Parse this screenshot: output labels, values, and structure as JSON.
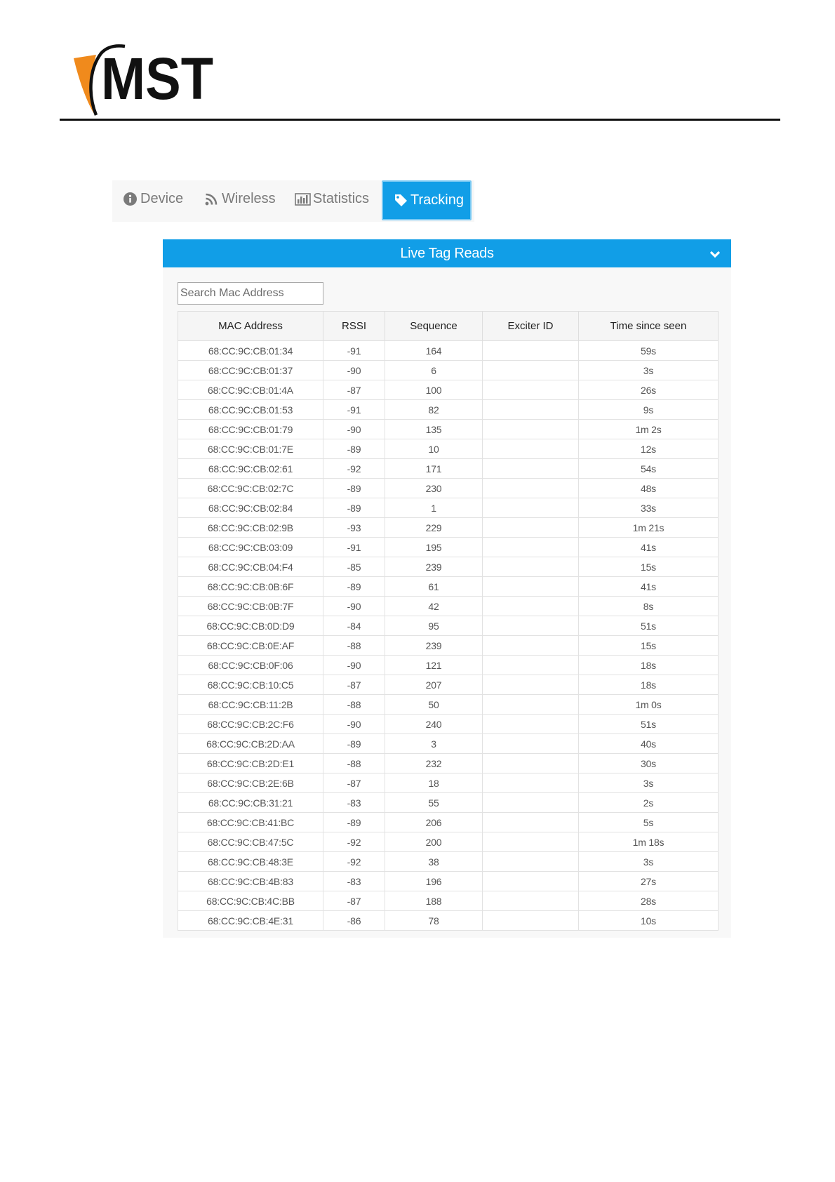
{
  "colors": {
    "primary": "#119ee7",
    "logo_orange": "#f08a1c",
    "logo_ink": "#111111"
  },
  "logo": {
    "text": "MST"
  },
  "tabs": [
    {
      "label": "Device",
      "icon": "info-circle-icon",
      "active": false
    },
    {
      "label": "Wireless",
      "icon": "rss-icon",
      "active": false
    },
    {
      "label": "Statistics",
      "icon": "bar-chart-icon",
      "active": false
    },
    {
      "label": "Tracking",
      "icon": "tag-icon",
      "active": true
    }
  ],
  "panel": {
    "title": "Live Tag Reads",
    "collapse_icon": "chevron-down-icon"
  },
  "search": {
    "placeholder": "Search Mac Address",
    "value": ""
  },
  "table": {
    "columns": [
      "MAC Address",
      "RSSI",
      "Sequence",
      "Exciter ID",
      "Time since seen"
    ],
    "rows": [
      [
        "68:CC:9C:CB:01:34",
        "-91",
        "164",
        "",
        "59s"
      ],
      [
        "68:CC:9C:CB:01:37",
        "-90",
        "6",
        "",
        "3s"
      ],
      [
        "68:CC:9C:CB:01:4A",
        "-87",
        "100",
        "",
        "26s"
      ],
      [
        "68:CC:9C:CB:01:53",
        "-91",
        "82",
        "",
        "9s"
      ],
      [
        "68:CC:9C:CB:01:79",
        "-90",
        "135",
        "",
        "1m 2s"
      ],
      [
        "68:CC:9C:CB:01:7E",
        "-89",
        "10",
        "",
        "12s"
      ],
      [
        "68:CC:9C:CB:02:61",
        "-92",
        "171",
        "",
        "54s"
      ],
      [
        "68:CC:9C:CB:02:7C",
        "-89",
        "230",
        "",
        "48s"
      ],
      [
        "68:CC:9C:CB:02:84",
        "-89",
        "1",
        "",
        "33s"
      ],
      [
        "68:CC:9C:CB:02:9B",
        "-93",
        "229",
        "",
        "1m 21s"
      ],
      [
        "68:CC:9C:CB:03:09",
        "-91",
        "195",
        "",
        "41s"
      ],
      [
        "68:CC:9C:CB:04:F4",
        "-85",
        "239",
        "",
        "15s"
      ],
      [
        "68:CC:9C:CB:0B:6F",
        "-89",
        "61",
        "",
        "41s"
      ],
      [
        "68:CC:9C:CB:0B:7F",
        "-90",
        "42",
        "",
        "8s"
      ],
      [
        "68:CC:9C:CB:0D:D9",
        "-84",
        "95",
        "",
        "51s"
      ],
      [
        "68:CC:9C:CB:0E:AF",
        "-88",
        "239",
        "",
        "15s"
      ],
      [
        "68:CC:9C:CB:0F:06",
        "-90",
        "121",
        "",
        "18s"
      ],
      [
        "68:CC:9C:CB:10:C5",
        "-87",
        "207",
        "",
        "18s"
      ],
      [
        "68:CC:9C:CB:11:2B",
        "-88",
        "50",
        "",
        "1m 0s"
      ],
      [
        "68:CC:9C:CB:2C:F6",
        "-90",
        "240",
        "",
        "51s"
      ],
      [
        "68:CC:9C:CB:2D:AA",
        "-89",
        "3",
        "",
        "40s"
      ],
      [
        "68:CC:9C:CB:2D:E1",
        "-88",
        "232",
        "",
        "30s"
      ],
      [
        "68:CC:9C:CB:2E:6B",
        "-87",
        "18",
        "",
        "3s"
      ],
      [
        "68:CC:9C:CB:31:21",
        "-83",
        "55",
        "",
        "2s"
      ],
      [
        "68:CC:9C:CB:41:BC",
        "-89",
        "206",
        "",
        "5s"
      ],
      [
        "68:CC:9C:CB:47:5C",
        "-92",
        "200",
        "",
        "1m 18s"
      ],
      [
        "68:CC:9C:CB:48:3E",
        "-92",
        "38",
        "",
        "3s"
      ],
      [
        "68:CC:9C:CB:4B:83",
        "-83",
        "196",
        "",
        "27s"
      ],
      [
        "68:CC:9C:CB:4C:BB",
        "-87",
        "188",
        "",
        "28s"
      ],
      [
        "68:CC:9C:CB:4E:31",
        "-86",
        "78",
        "",
        "10s"
      ]
    ]
  }
}
